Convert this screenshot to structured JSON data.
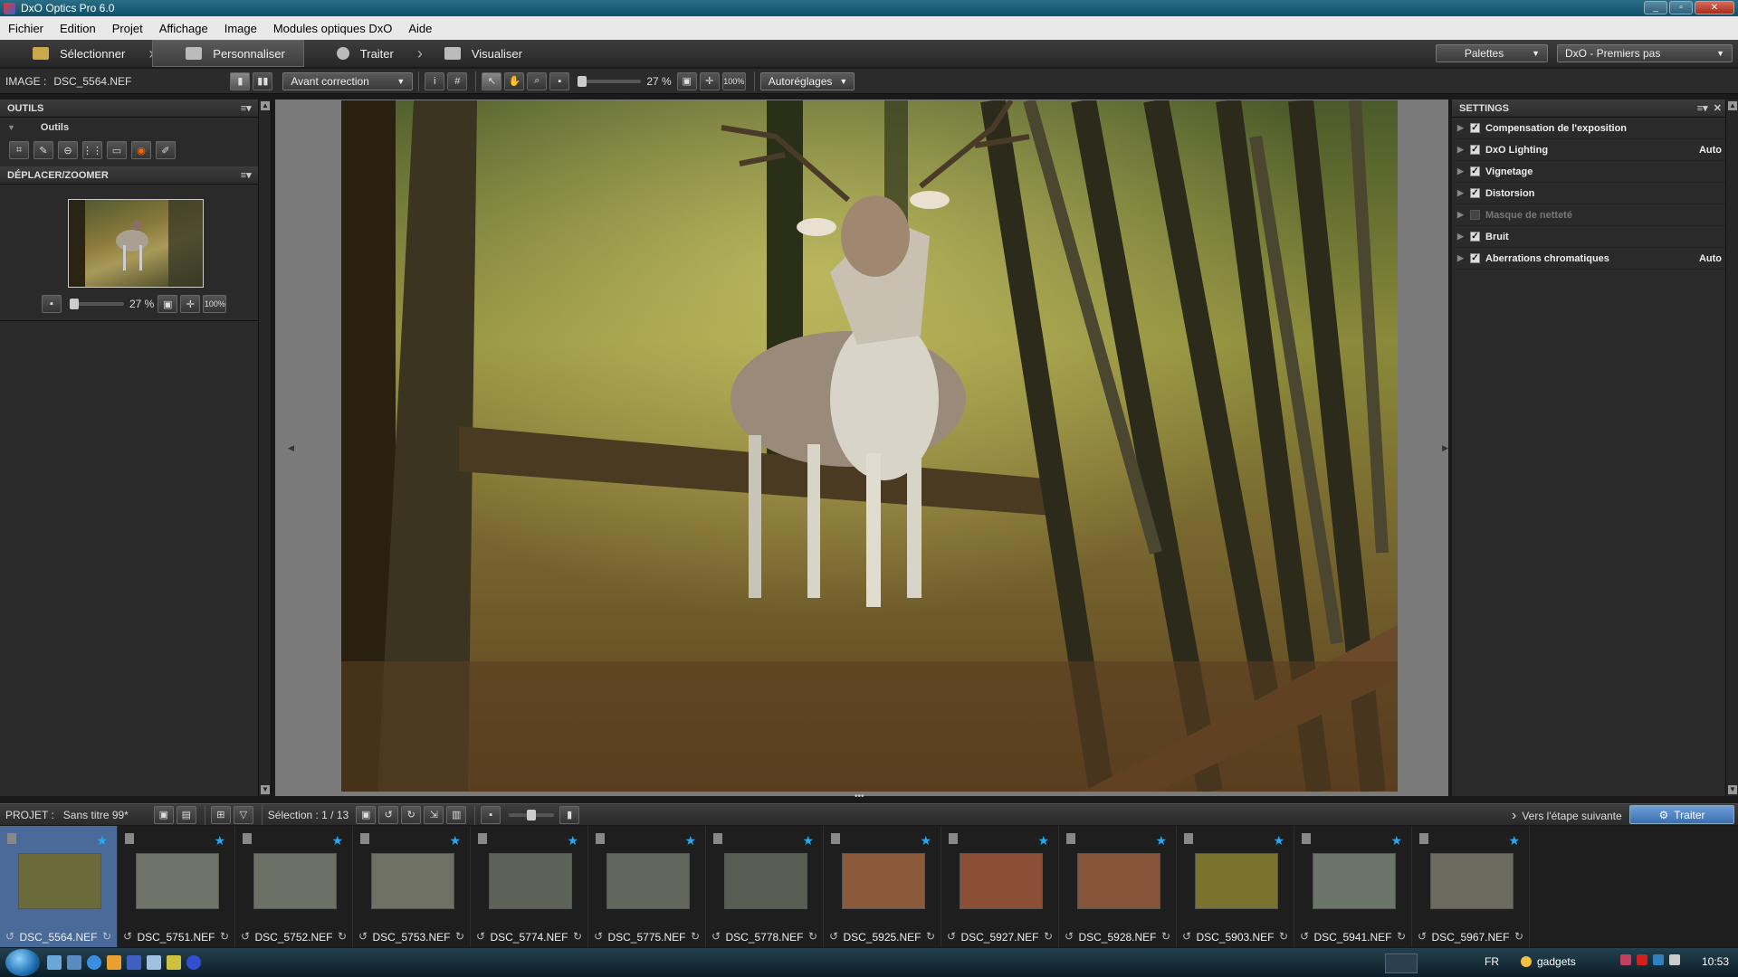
{
  "window": {
    "title": "DxO Optics Pro 6.0"
  },
  "menu": [
    "Fichier",
    "Edition",
    "Projet",
    "Affichage",
    "Image",
    "Modules optiques DxO",
    "Aide"
  ],
  "steps": [
    {
      "label": "Sélectionner",
      "icon": "folder-icon"
    },
    {
      "label": "Personnaliser",
      "icon": "customize-icon"
    },
    {
      "label": "Traiter",
      "icon": "process-icon"
    },
    {
      "label": "Visualiser",
      "icon": "view-icon"
    }
  ],
  "top_right": {
    "palettes": "Palettes",
    "workspace": "DxO - Premiers pas"
  },
  "toolbar": {
    "image_label": "IMAGE :",
    "image_name": "DSC_5564.NEF",
    "compare_mode": "Avant correction",
    "zoom": "27 %",
    "zoom_100": "100%",
    "auto_settings": "Autoréglages"
  },
  "left": {
    "tools_header": "OUTILS",
    "tools_group": "Outils",
    "nav_header": "DÉPLACER/ZOOMER",
    "nav_zoom": "27 %",
    "nav_100": "100%"
  },
  "right": {
    "header": "SETTINGS",
    "items": [
      {
        "label": "Compensation de l'exposition",
        "checked": true,
        "value": ""
      },
      {
        "label": "DxO Lighting",
        "checked": true,
        "value": "Auto"
      },
      {
        "label": "Vignetage",
        "checked": true,
        "value": ""
      },
      {
        "label": "Distorsion",
        "checked": true,
        "value": ""
      },
      {
        "label": "Masque de netteté",
        "checked": false,
        "value": ""
      },
      {
        "label": "Bruit",
        "checked": true,
        "value": ""
      },
      {
        "label": "Aberrations chromatiques",
        "checked": true,
        "value": "Auto"
      }
    ]
  },
  "project": {
    "label": "PROJET :",
    "name": "Sans titre 99*",
    "selection": "Sélection : 1 / 13",
    "next_step": "Vers l'étape suivante",
    "process_button": "Traiter"
  },
  "thumbs": [
    {
      "name": "DSC_5564.NEF",
      "selected": true,
      "tone": "#6b6a3a"
    },
    {
      "name": "DSC_5751.NEF",
      "selected": false,
      "tone": "#707468"
    },
    {
      "name": "DSC_5752.NEF",
      "selected": false,
      "tone": "#6d7064"
    },
    {
      "name": "DSC_5753.NEF",
      "selected": false,
      "tone": "#6f7165"
    },
    {
      "name": "DSC_5774.NEF",
      "selected": false,
      "tone": "#5d6258"
    },
    {
      "name": "DSC_5775.NEF",
      "selected": false,
      "tone": "#63665c"
    },
    {
      "name": "DSC_5778.NEF",
      "selected": false,
      "tone": "#585c52"
    },
    {
      "name": "DSC_5925.NEF",
      "selected": false,
      "tone": "#8a5a3a"
    },
    {
      "name": "DSC_5927.NEF",
      "selected": false,
      "tone": "#8c4f35"
    },
    {
      "name": "DSC_5928.NEF",
      "selected": false,
      "tone": "#87553a"
    },
    {
      "name": "DSC_5903.NEF",
      "selected": false,
      "tone": "#7a7330"
    },
    {
      "name": "DSC_5941.NEF",
      "selected": false,
      "tone": "#6a7468"
    },
    {
      "name": "DSC_5967.NEF",
      "selected": false,
      "tone": "#6b6b60"
    }
  ],
  "taskbar": {
    "lang": "FR",
    "gadgets": "gadgets",
    "time": "10:53"
  }
}
